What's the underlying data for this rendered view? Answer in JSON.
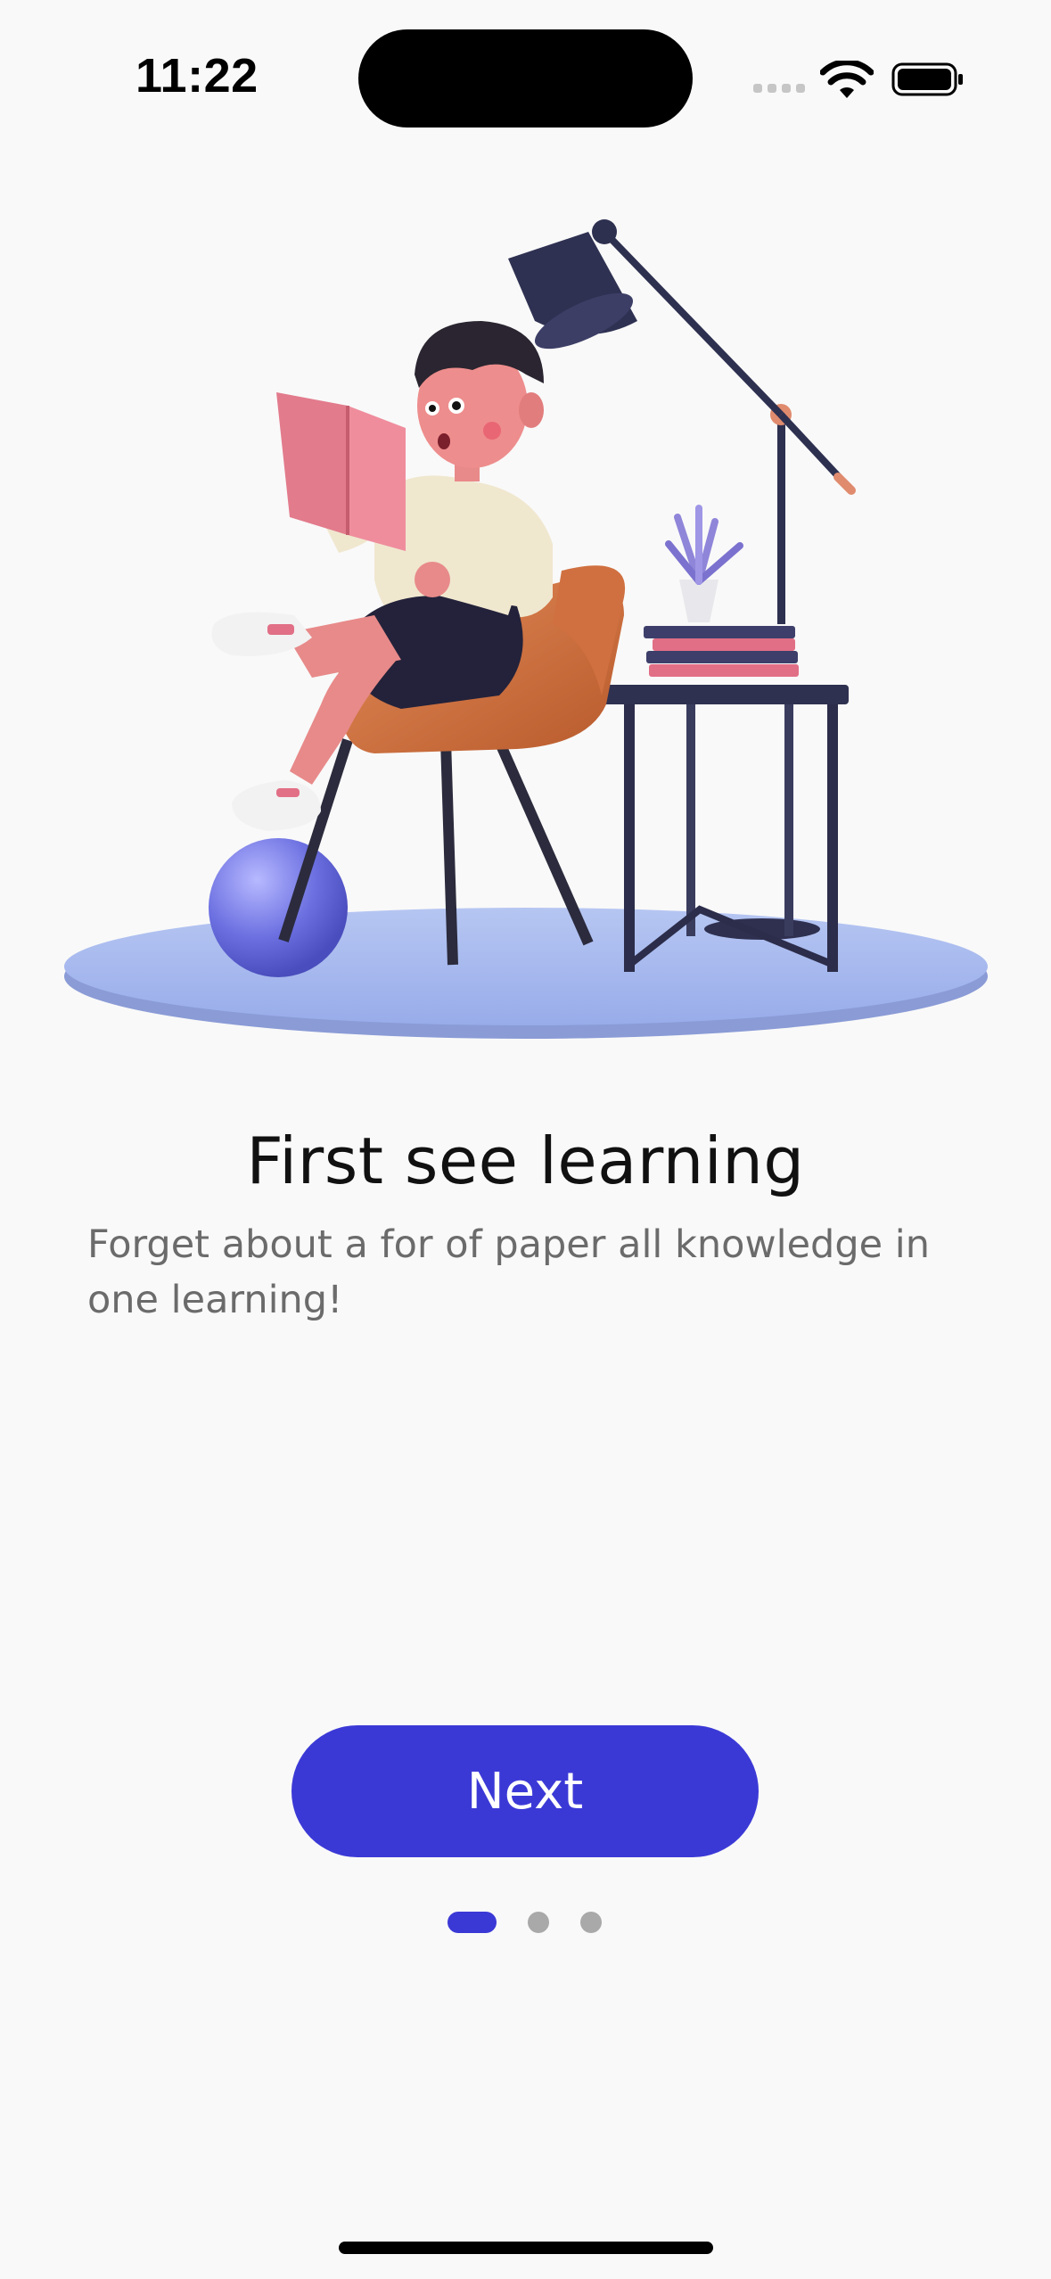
{
  "status_bar": {
    "time": "11:22",
    "icons": [
      "cellular-signal-icon",
      "wifi-icon",
      "battery-icon"
    ]
  },
  "onboarding": {
    "illustration": "person-reading-in-armchair-illustration",
    "title": "First see learning",
    "subtitle": "Forget about a for of paper all knowledge in one learning!",
    "next_label": "Next",
    "pagination": {
      "current_page": 1,
      "total_pages": 3
    }
  },
  "colors": {
    "accent": "#3b39d6",
    "background": "#f9f9f9",
    "inactive_dot": "#a9a9a9",
    "subtitle_text": "#6b6b6b"
  }
}
